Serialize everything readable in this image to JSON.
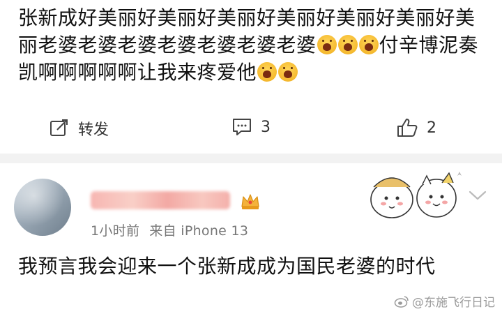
{
  "post": {
    "text_main": "张新成好美丽好美丽好美丽好美丽好美丽好美丽好美丽老婆老婆老婆老婆老婆老婆老婆",
    "text_tail_before": "付辛博泥奏凯啊啊啊啊啊让我来疼爱他",
    "emoji_name": "crying-emoji-icon"
  },
  "actions": {
    "repost_label": "转发",
    "comment_count": "3",
    "like_count": "2"
  },
  "comment": {
    "time": "1小时前",
    "source": "来自 iPhone 13",
    "text": "我预言我会迎来一个张新成成为国民老婆的时代"
  },
  "watermark": {
    "text": "@东施飞行日记"
  }
}
